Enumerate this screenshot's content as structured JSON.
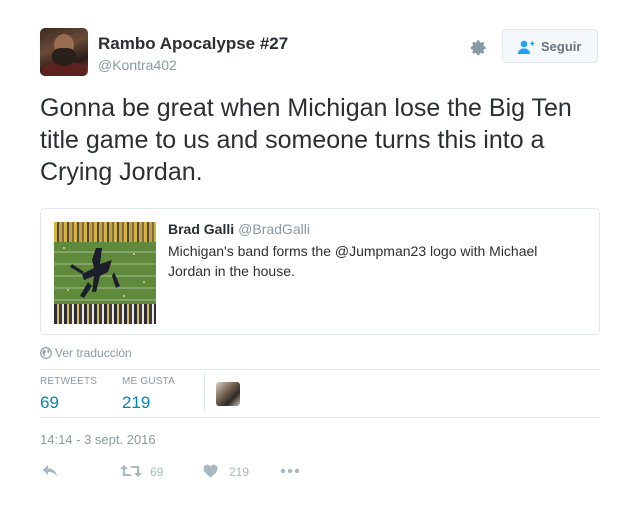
{
  "author": {
    "display_name": "Rambo Apocalypse #27",
    "handle": "@Kontra402"
  },
  "follow_button": {
    "label": "Seguir"
  },
  "tweet": {
    "text": "Gonna be great when Michigan lose the Big Ten title game to us and someone turns this into a Crying Jordan."
  },
  "quoted_tweet": {
    "name": "Brad Galli",
    "handle": "@BradGalli",
    "text": "Michigan's band forms the @Jumpman23 logo with Michael Jordan in the house."
  },
  "translate_link": {
    "label": "Ver traducción",
    "icon": "globe-icon"
  },
  "stats": {
    "retweets_label": "RETWEETS",
    "retweets_value": "69",
    "likes_label": "ME GUSTA",
    "likes_value": "219"
  },
  "timestamp": "14:14 - 3 sept. 2016",
  "actions": {
    "reply_icon": "reply-icon",
    "retweet_icon": "retweet-icon",
    "retweet_count": "69",
    "like_icon": "heart-icon",
    "like_count": "219",
    "more_icon": "more-icon"
  },
  "colors": {
    "link_blue": "#0084b4",
    "muted_gray": "#8899a6",
    "icon_gray": "#aab8c2",
    "text_dark": "#292f33",
    "border": "#e1e8ed"
  }
}
